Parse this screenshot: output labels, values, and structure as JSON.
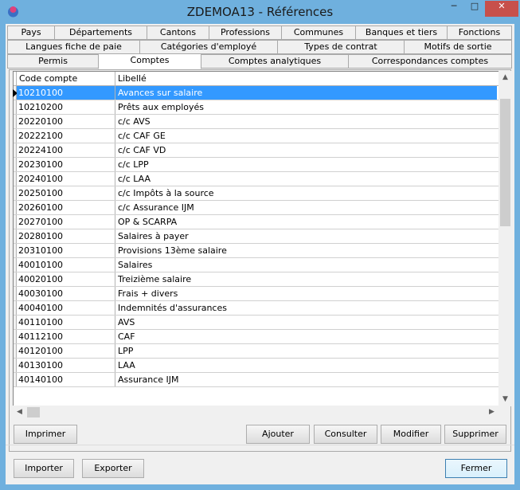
{
  "window": {
    "title": "ZDEMOA13 - Références",
    "min_glyph": "─",
    "max_glyph": "□",
    "close_glyph": "✕"
  },
  "tabs": {
    "row1": [
      "Pays",
      "Départements",
      "Cantons",
      "Professions",
      "Communes",
      "Banques et tiers",
      "Fonctions"
    ],
    "row2": [
      "Langues fiche de paie",
      "Catégories d'employé",
      "Types de contrat",
      "Motifs de sortie"
    ],
    "row3": [
      "Permis",
      "Comptes",
      "Comptes analytiques",
      "Correspondances comptes"
    ],
    "active": "Comptes"
  },
  "grid": {
    "columns": [
      "Code compte",
      "Libellé"
    ],
    "rows": [
      [
        "10210100",
        "Avances sur salaire"
      ],
      [
        "10210200",
        "Prêts aux employés"
      ],
      [
        "20220100",
        "c/c AVS"
      ],
      [
        "20222100",
        "c/c CAF GE"
      ],
      [
        "20224100",
        "c/c CAF VD"
      ],
      [
        "20230100",
        "c/c LPP"
      ],
      [
        "20240100",
        "c/c LAA"
      ],
      [
        "20250100",
        "c/c Impôts à la source"
      ],
      [
        "20260100",
        "c/c Assurance IJM"
      ],
      [
        "20270100",
        "OP & SCARPA"
      ],
      [
        "20280100",
        "Salaires à payer"
      ],
      [
        "20310100",
        "Provisions 13ème salaire"
      ],
      [
        "40010100",
        "Salaires"
      ],
      [
        "40020100",
        "Treizième salaire"
      ],
      [
        "40030100",
        "Frais + divers"
      ],
      [
        "40040100",
        "Indemnités d'assurances"
      ],
      [
        "40110100",
        "AVS"
      ],
      [
        "40112100",
        "CAF"
      ],
      [
        "40120100",
        "LPP"
      ],
      [
        "40130100",
        "LAA"
      ],
      [
        "40140100",
        "Assurance IJM"
      ]
    ],
    "selected_row": 0
  },
  "buttons": {
    "imprimer": "Imprimer",
    "ajouter": "Ajouter",
    "consulter": "Consulter",
    "modifier": "Modifier",
    "supprimer": "Supprimer",
    "importer": "Importer",
    "exporter": "Exporter",
    "fermer": "Fermer"
  },
  "colors": {
    "selection": "#3399ff",
    "close_button": "#c7504b",
    "frame": "#6fb0de"
  }
}
